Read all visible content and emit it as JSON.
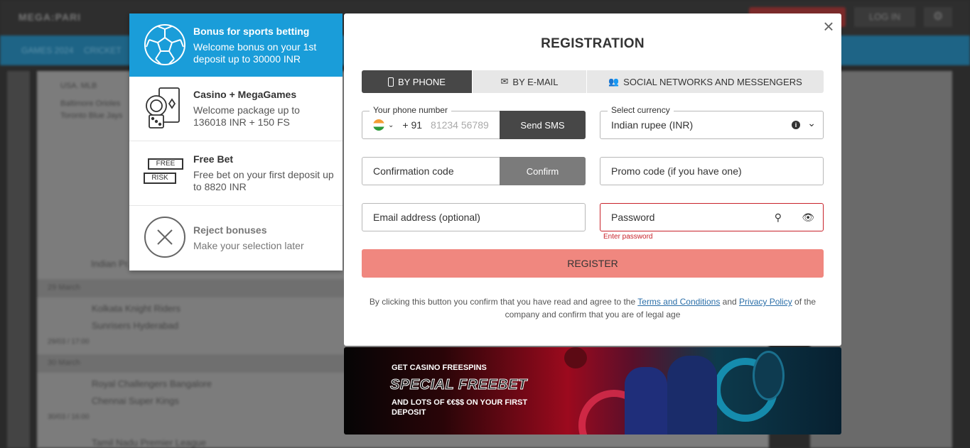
{
  "background": {
    "logo": "MEGA:PARI",
    "login": "LOG IN",
    "nav": [
      "GAMES 2024",
      "CRICKET"
    ],
    "league_top": "USA. MLB",
    "teams_top": [
      "Baltimore Orioles",
      "Toronto Blue Jays"
    ],
    "dates": [
      "29 March",
      "30 March"
    ],
    "matches": [
      {
        "home": "Kolkata Knight Riders",
        "away": "Sunrisers Hyderabad",
        "time": "29/03 / 17:00"
      },
      {
        "home": "Royal Challengers Bangalore",
        "away": "Chennai Super Kings",
        "time": "30/03 / 16:00"
      }
    ],
    "league_bottom": "Tamil Nadu Premier League",
    "league_mid": "Indian Pr..."
  },
  "bonuses": [
    {
      "icon": "soccer-ball-icon",
      "title": "Bonus for sports betting",
      "desc": "Welcome bonus on your 1st deposit up to 30000 INR",
      "selected": true
    },
    {
      "icon": "casino-cards-icon",
      "title": "Casino + MegaGames",
      "desc": "Welcome package up to 136018 INR + 150 FS"
    },
    {
      "icon": "free-bet-icon",
      "title": "Free Bet",
      "desc": "Free bet on your first deposit up to 8820 INR",
      "icon_text": [
        "FREE",
        "RISK"
      ]
    },
    {
      "icon": "close-circle-icon",
      "title": "Reject bonuses",
      "desc": "Make your selection later"
    }
  ],
  "modal": {
    "title": "REGISTRATION",
    "close": "×",
    "tabs": [
      "BY PHONE",
      "BY E-MAIL",
      "SOCIAL NETWORKS AND MESSENGERS"
    ],
    "phone_label": "Your phone number",
    "phone_code": "+ 91",
    "phone_placeholder": "81234 56789",
    "send_sms": "Send SMS",
    "currency_label": "Select currency",
    "currency_value": "Indian rupee (INR)",
    "confirmation_placeholder": "Confirmation code",
    "confirm": "Confirm",
    "promo_placeholder": "Promo code (if you have one)",
    "email_placeholder": "Email address (optional)",
    "password_placeholder": "Password",
    "password_error": "Enter password",
    "register": "REGISTER",
    "terms_1": "By clicking this button you confirm that you have read and agree to the ",
    "terms_link": "Terms and Conditions",
    "terms_and": " and ",
    "privacy_link": "Privacy Policy",
    "terms_2": " of the company and confirm that you are of legal age"
  },
  "banner": {
    "line1": "GET CASINO FREESPINS",
    "line2": "SPECIAL FREEBET",
    "line3": "AND LOTS OF €€$$ ON YOUR FIRST DEPOSIT"
  },
  "colors": {
    "accent": "#1a9dd9",
    "register": "#f0877f",
    "error": "#c8222a",
    "dark": "#474747"
  }
}
